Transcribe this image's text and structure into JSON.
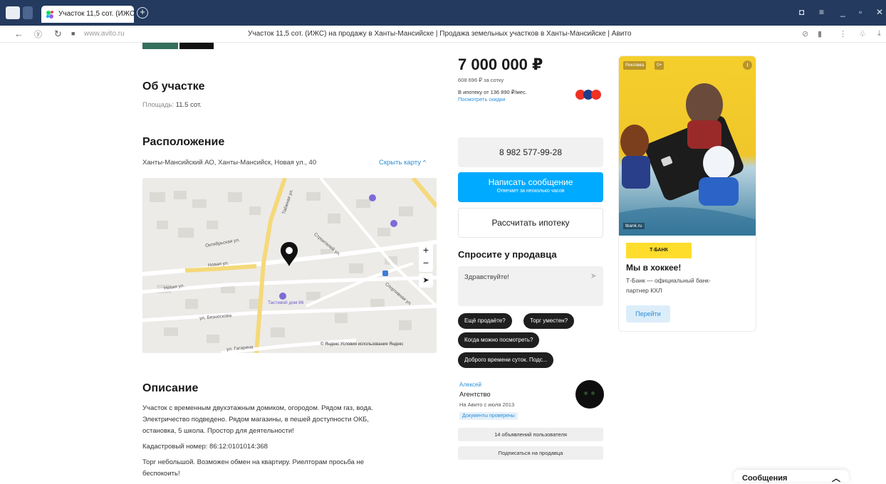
{
  "browser": {
    "tab_title": "Участок 11,5 сот. (ИЖС ×",
    "url": "www.avito.ru",
    "page_title": "Участок 11,5 сот. (ИЖС) на продажу в Ханты-Мансийске | Продажа земельных участков в Ханты-Мансийске | Авито"
  },
  "about": {
    "heading": "Об участке",
    "area_label": "Площадь:",
    "area_value": "11.5 сот."
  },
  "location": {
    "heading": "Расположение",
    "address": "Ханты-Мансийский АО, Ханты-Мансийск, Новая ул., 40",
    "hide_map": "Скрыть карту ^",
    "map": {
      "streets": [
        "Новая ул.",
        "Октябрьская ул.",
        "Новая ул.",
        "ул. Безноскова",
        "ул. Гагарина",
        "Таёжная ул.",
        "Строителей ул.",
        "Спортивная ул."
      ],
      "poi": [
        "Тастевой дом 86"
      ],
      "attribution": "© Яндекс  Условия использования  Яндекс"
    }
  },
  "description": {
    "heading": "Описание",
    "p1": "Участок с временным двухэтажным домиком, огородом. Рядом газ, вода.",
    "p2": "Электричество подведено. Рядом магазины, в пешей доступности ОКБ,",
    "p3": "остановка, 5 школа. Простор для деятельности!",
    "p4": "Кадастровый номер: 86:12:0101014:368",
    "p5": "Торг небольшой. Возможен обмен на квартиру. Риелторам просьба не",
    "p6": "беспокоить!"
  },
  "price": {
    "value": "7 000 000 ₽",
    "per_sotka": "608 696 ₽ за сотку",
    "mortgage": "В ипотеку от 136 890 ₽/мес.",
    "discounts": "Посмотреть скидки"
  },
  "buttons": {
    "phone": "8 982 577-99-28",
    "write": "Написать сообщение",
    "write_sub": "Отвечает за несколько часов",
    "calc": "Рассчитать ипотеку"
  },
  "ask": {
    "heading": "Спросите у продавца",
    "placeholder": "Здравствуйте!",
    "chips": [
      "Ещё продаёте?",
      "Торг уместен?",
      "Когда можно посмотреть?",
      "Доброго времени суток. Подс..."
    ]
  },
  "seller": {
    "name": "Алексей",
    "type": "Агентство",
    "since": "На Авито с июля 2013",
    "verified": "Документы проверены",
    "listings": "14 объявлений пользователя",
    "subscribe": "Подписаться на продавца"
  },
  "ad": {
    "label": "Реклама",
    "age": "0+",
    "source": "tbank.ru",
    "bank": "Т-БАНК",
    "title": "Мы в хоккее!",
    "text1": "Т-Банк — официальный банк-",
    "text2": "партнер КХЛ",
    "cta": "Перейти"
  },
  "messages_panel": {
    "label": "Сообщения"
  },
  "colors": {
    "accent_blue": "#00aaff",
    "link_blue": "#2a8ed8",
    "tabbar": "#243a5e",
    "ad_yellow": "#ffdd2d"
  }
}
